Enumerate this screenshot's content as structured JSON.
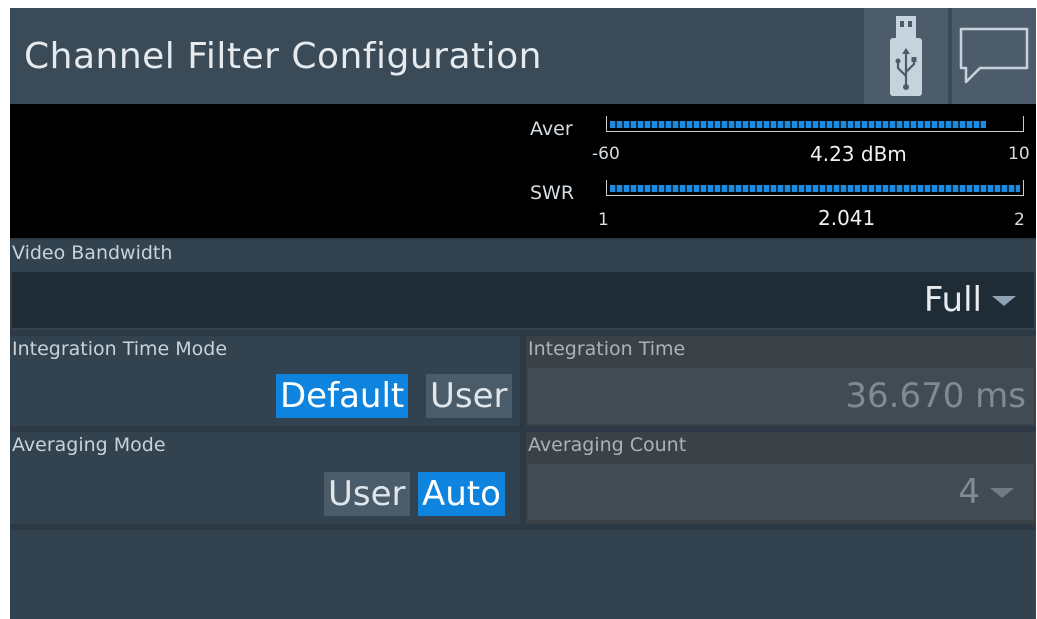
{
  "window": {
    "title": "Channel Filter Configuration",
    "usb_icon": "usb-icon",
    "message_icon": "message-icon"
  },
  "meters": {
    "average": {
      "label": "Aver",
      "min": "-60",
      "max": "10",
      "value": "4.23 dBm",
      "fill_fraction": 0.917
    },
    "swr": {
      "label": "SWR",
      "min": "1",
      "max": "2",
      "value": "2.041",
      "fill_fraction": 1.0
    }
  },
  "video_bandwidth": {
    "label": "Video Bandwidth",
    "value": "Full"
  },
  "integration_time_mode": {
    "label": "Integration Time Mode",
    "options": [
      "Default",
      "User"
    ],
    "selected": "Default"
  },
  "integration_time": {
    "label": "Integration Time",
    "value": "36.670 ms"
  },
  "averaging_mode": {
    "label": "Averaging Mode",
    "options": [
      "User",
      "Auto"
    ],
    "selected": "Auto"
  },
  "averaging_count": {
    "label": "Averaging Count",
    "value": "4"
  },
  "colors": {
    "accent": "#0f84de",
    "background": "#2d3a45",
    "meter_bar": "#1a8be0"
  }
}
